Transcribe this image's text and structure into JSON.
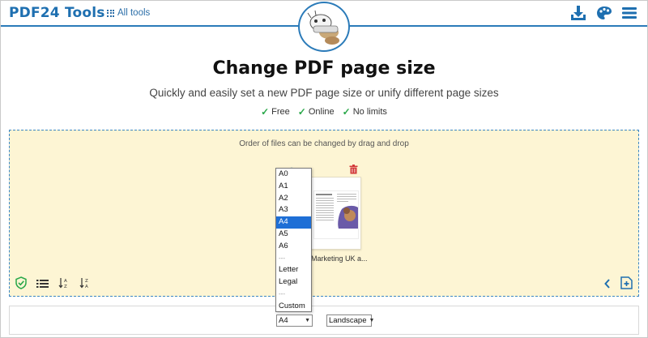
{
  "header": {
    "brand": "PDF24 Tools",
    "all_tools_label": "All tools",
    "icons": [
      "grid-icon",
      "download-icon",
      "palette-icon",
      "menu-icon"
    ]
  },
  "hero": {
    "title": "Change PDF page size",
    "subtitle": "Quickly and easily set a new PDF page size or unify different page sizes",
    "features": [
      "Free",
      "Online",
      "No limits"
    ]
  },
  "dropzone": {
    "hint": "Order of files can be changed by drag and drop",
    "file_name": "Marketing UK a..."
  },
  "page_size": {
    "options": [
      "A0",
      "A1",
      "A2",
      "A3",
      "A4",
      "A5",
      "A6",
      "---",
      "Letter",
      "Legal",
      "---",
      "Custom"
    ],
    "selected": "A4"
  },
  "orientation": {
    "selected": "Landscape"
  },
  "colors": {
    "accent": "#1e6fb0",
    "dropzone_bg": "#fdf5d4",
    "check": "#2aa84a",
    "selected_option": "#1e6fd6"
  }
}
